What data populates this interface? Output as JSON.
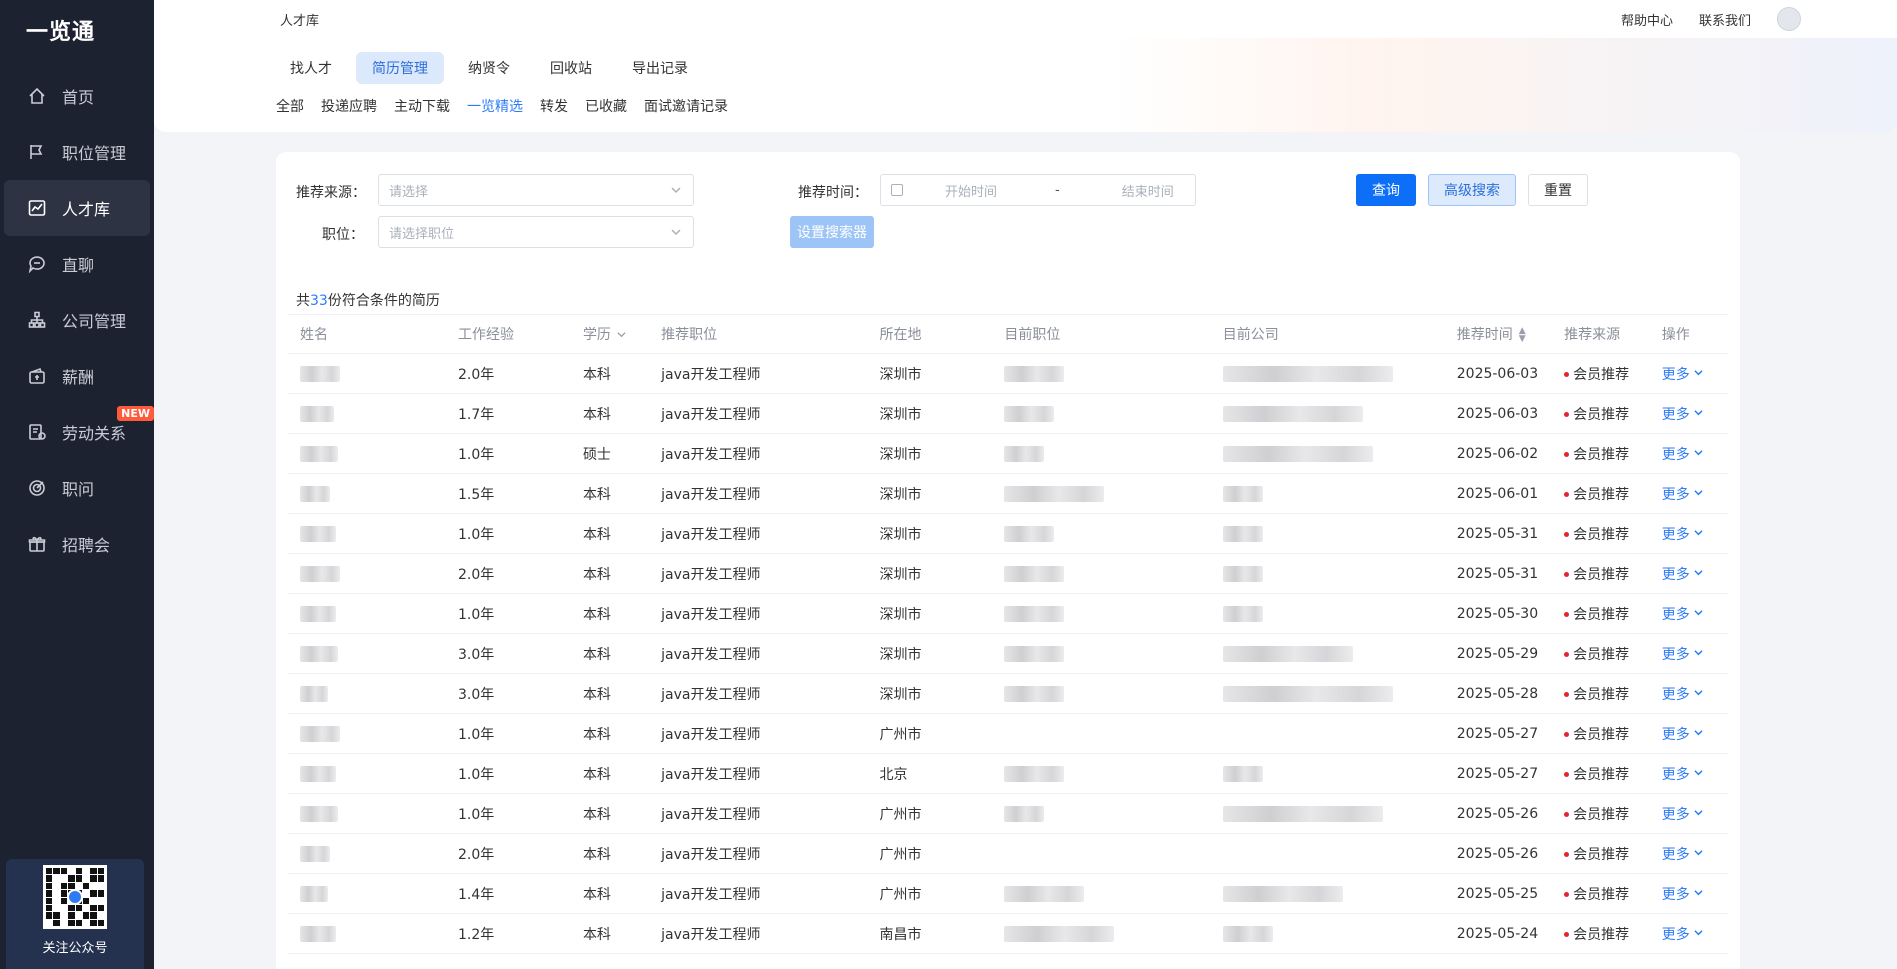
{
  "brand": "一览通",
  "sidebar": {
    "items": [
      {
        "label": "首页",
        "icon": "home-icon"
      },
      {
        "label": "职位管理",
        "icon": "flag-icon"
      },
      {
        "label": "人才库",
        "icon": "chart-icon",
        "active": true
      },
      {
        "label": "直聊",
        "icon": "chat-icon"
      },
      {
        "label": "公司管理",
        "icon": "org-icon"
      },
      {
        "label": "薪酬",
        "icon": "wallet-icon"
      },
      {
        "label": "劳动关系",
        "icon": "contract-icon",
        "badge": "NEW"
      },
      {
        "label": "职问",
        "icon": "target-icon"
      },
      {
        "label": "招聘会",
        "icon": "gift-icon"
      }
    ],
    "qr_caption": "关注公众号"
  },
  "topbar": {
    "crumb": "人才库",
    "help": "帮助中心",
    "contact": "联系我们"
  },
  "tabs": [
    "找人才",
    "简历管理",
    "纳贤令",
    "回收站",
    "导出记录"
  ],
  "active_tab": "简历管理",
  "subtabs": [
    "全部",
    "投递应聘",
    "主动下载",
    "一览精选",
    "转发",
    "已收藏",
    "面试邀请记录"
  ],
  "active_subtab": "一览精选",
  "filters": {
    "source_label": "推荐来源：",
    "source_placeholder": "请选择",
    "time_label": "推荐时间：",
    "start_placeholder": "开始时间",
    "range_sep": "-",
    "end_placeholder": "结束时间",
    "position_label": "职位：",
    "position_placeholder": "请选择职位",
    "query": "查询",
    "advanced": "高级搜索",
    "reset": "重置",
    "set_searcher": "设置搜索器"
  },
  "summary": {
    "prefix": "共",
    "count": "33",
    "suffix": "份符合条件的简历"
  },
  "table": {
    "headers": [
      "姓名",
      "工作经验",
      "学历",
      "推荐职位",
      "所在地",
      "目前职位",
      "目前公司",
      "推荐时间",
      "推荐来源",
      "操作"
    ],
    "more_label": "更多",
    "rows": [
      {
        "exp": "2.0年",
        "edu": "本科",
        "pos": "java开发工程师",
        "loc": "深圳市",
        "time": "2025-06-03",
        "src": "会员推荐"
      },
      {
        "exp": "1.7年",
        "edu": "本科",
        "pos": "java开发工程师",
        "loc": "深圳市",
        "time": "2025-06-03",
        "src": "会员推荐"
      },
      {
        "exp": "1.0年",
        "edu": "硕士",
        "pos": "java开发工程师",
        "loc": "深圳市",
        "time": "2025-06-02",
        "src": "会员推荐"
      },
      {
        "exp": "1.5年",
        "edu": "本科",
        "pos": "java开发工程师",
        "loc": "深圳市",
        "time": "2025-06-01",
        "src": "会员推荐"
      },
      {
        "exp": "1.0年",
        "edu": "本科",
        "pos": "java开发工程师",
        "loc": "深圳市",
        "time": "2025-05-31",
        "src": "会员推荐"
      },
      {
        "exp": "2.0年",
        "edu": "本科",
        "pos": "java开发工程师",
        "loc": "深圳市",
        "time": "2025-05-31",
        "src": "会员推荐"
      },
      {
        "exp": "1.0年",
        "edu": "本科",
        "pos": "java开发工程师",
        "loc": "深圳市",
        "time": "2025-05-30",
        "src": "会员推荐"
      },
      {
        "exp": "3.0年",
        "edu": "本科",
        "pos": "java开发工程师",
        "loc": "深圳市",
        "time": "2025-05-29",
        "src": "会员推荐"
      },
      {
        "exp": "3.0年",
        "edu": "本科",
        "pos": "java开发工程师",
        "loc": "深圳市",
        "time": "2025-05-28",
        "src": "会员推荐"
      },
      {
        "exp": "1.0年",
        "edu": "本科",
        "pos": "java开发工程师",
        "loc": "广州市",
        "time": "2025-05-27",
        "src": "会员推荐"
      },
      {
        "exp": "1.0年",
        "edu": "本科",
        "pos": "java开发工程师",
        "loc": "北京",
        "time": "2025-05-27",
        "src": "会员推荐"
      },
      {
        "exp": "1.0年",
        "edu": "本科",
        "pos": "java开发工程师",
        "loc": "广州市",
        "time": "2025-05-26",
        "src": "会员推荐"
      },
      {
        "exp": "2.0年",
        "edu": "本科",
        "pos": "java开发工程师",
        "loc": "广州市",
        "time": "2025-05-26",
        "src": "会员推荐"
      },
      {
        "exp": "1.4年",
        "edu": "本科",
        "pos": "java开发工程师",
        "loc": "广州市",
        "time": "2025-05-25",
        "src": "会员推荐"
      },
      {
        "exp": "1.2年",
        "edu": "本科",
        "pos": "java开发工程师",
        "loc": "南昌市",
        "time": "2025-05-24",
        "src": "会员推荐"
      }
    ]
  }
}
